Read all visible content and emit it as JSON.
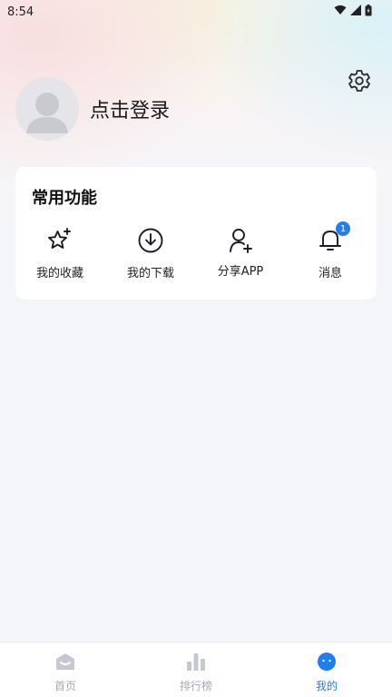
{
  "status_bar": {
    "time": "8:54",
    "icons": [
      "wifi-icon",
      "cellular-signal-icon",
      "battery-icon"
    ]
  },
  "header": {
    "login_text": "点击登录",
    "avatar": "default-avatar",
    "settings_icon": "gear-icon"
  },
  "common_functions": {
    "title": "常用功能",
    "items": [
      {
        "label": "我的收藏",
        "icon": "star-sparkle-icon"
      },
      {
        "label": "我的下载",
        "icon": "download-icon"
      },
      {
        "label": "分享APP",
        "icon": "add-user-icon"
      },
      {
        "label": "消息",
        "icon": "bell-icon",
        "badge": "1"
      }
    ]
  },
  "tab_bar": {
    "items": [
      {
        "label": "首页",
        "icon": "home-icon",
        "active": false
      },
      {
        "label": "排行榜",
        "icon": "bar-chart-icon",
        "active": false
      },
      {
        "label": "我的",
        "icon": "profile-face-icon",
        "active": true
      }
    ]
  },
  "colors": {
    "accent": "#1f7ef2",
    "inactive_tab": "#a6a9b3",
    "page_bg": "#f4f5f8"
  }
}
